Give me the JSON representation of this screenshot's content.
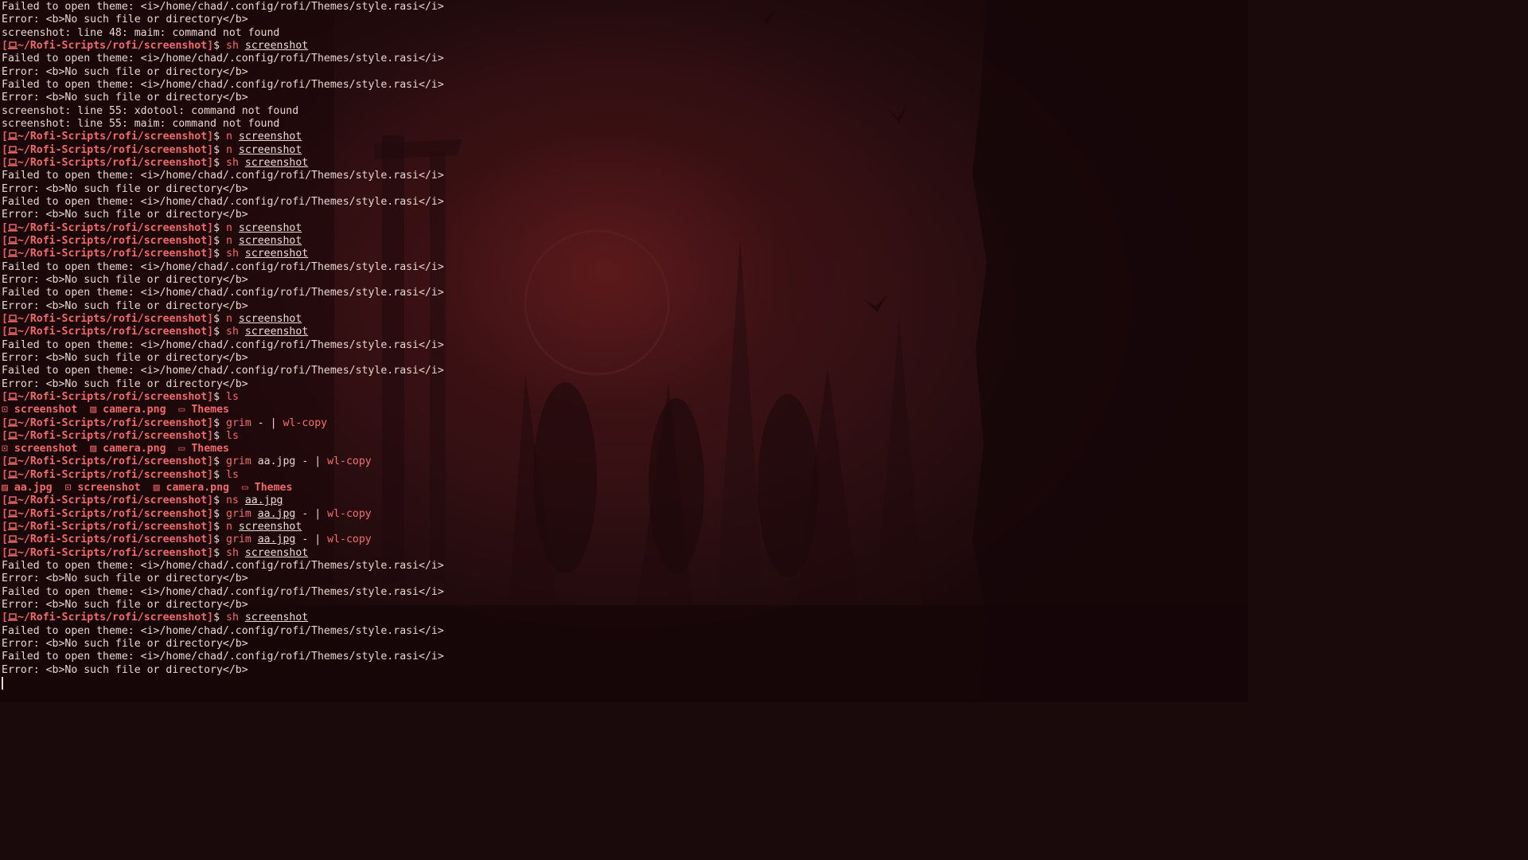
{
  "theme": {
    "prompt_color": "#f06a6c",
    "text_color": "#e8d6cf",
    "background": "#2a0d10"
  },
  "prompt": {
    "path": "~/Rofi-Scripts/rofi/screenshot",
    "open_bracket": "[",
    "close_bracket": "]",
    "dollar": "$",
    "icon": "laptop-icon"
  },
  "lines": [
    {
      "type": "out",
      "text": "Failed to open theme: <i>/home/chad/.config/rofi/Themes/style.rasi</i>"
    },
    {
      "type": "out",
      "text": "Error: <b>No such file or directory</b>"
    },
    {
      "type": "out",
      "text": "screenshot: line 48: maim: command not found"
    },
    {
      "type": "cmd",
      "cmd": "sh",
      "args": [
        {
          "t": "screenshot",
          "u": true
        }
      ]
    },
    {
      "type": "out",
      "text": "Failed to open theme: <i>/home/chad/.config/rofi/Themes/style.rasi</i>"
    },
    {
      "type": "out",
      "text": "Error: <b>No such file or directory</b>"
    },
    {
      "type": "out",
      "text": "Failed to open theme: <i>/home/chad/.config/rofi/Themes/style.rasi</i>"
    },
    {
      "type": "out",
      "text": "Error: <b>No such file or directory</b>"
    },
    {
      "type": "out",
      "text": "screenshot: line 55: xdotool: command not found"
    },
    {
      "type": "out",
      "text": "screenshot: line 55: maim: command not found"
    },
    {
      "type": "cmd",
      "cmd": "n",
      "args": [
        {
          "t": "screenshot",
          "u": true
        }
      ]
    },
    {
      "type": "cmd",
      "cmd": "n",
      "args": [
        {
          "t": "screenshot",
          "u": true
        }
      ]
    },
    {
      "type": "cmd",
      "cmd": "sh",
      "args": [
        {
          "t": "screenshot",
          "u": true
        }
      ]
    },
    {
      "type": "out",
      "text": "Failed to open theme: <i>/home/chad/.config/rofi/Themes/style.rasi</i>"
    },
    {
      "type": "out",
      "text": "Error: <b>No such file or directory</b>"
    },
    {
      "type": "out",
      "text": "Failed to open theme: <i>/home/chad/.config/rofi/Themes/style.rasi</i>"
    },
    {
      "type": "out",
      "text": "Error: <b>No such file or directory</b>"
    },
    {
      "type": "cmd",
      "cmd": "n",
      "args": [
        {
          "t": "screenshot",
          "u": true
        }
      ]
    },
    {
      "type": "cmd",
      "cmd": "n",
      "args": [
        {
          "t": "screenshot",
          "u": true
        }
      ]
    },
    {
      "type": "cmd",
      "cmd": "sh",
      "args": [
        {
          "t": "screenshot",
          "u": true
        }
      ]
    },
    {
      "type": "out",
      "text": "Failed to open theme: <i>/home/chad/.config/rofi/Themes/style.rasi</i>"
    },
    {
      "type": "out",
      "text": "Error: <b>No such file or directory</b>"
    },
    {
      "type": "out",
      "text": "Failed to open theme: <i>/home/chad/.config/rofi/Themes/style.rasi</i>"
    },
    {
      "type": "out",
      "text": "Error: <b>No such file or directory</b>"
    },
    {
      "type": "cmd",
      "cmd": "n",
      "args": [
        {
          "t": "screenshot",
          "u": true
        }
      ]
    },
    {
      "type": "cmd",
      "cmd": "sh",
      "args": [
        {
          "t": "screenshot",
          "u": true
        }
      ]
    },
    {
      "type": "out",
      "text": "Failed to open theme: <i>/home/chad/.config/rofi/Themes/style.rasi</i>"
    },
    {
      "type": "out",
      "text": "Error: <b>No such file or directory</b>"
    },
    {
      "type": "out",
      "text": "Failed to open theme: <i>/home/chad/.config/rofi/Themes/style.rasi</i>"
    },
    {
      "type": "out",
      "text": "Error: <b>No such file or directory</b>"
    },
    {
      "type": "cmd",
      "cmd": "ls",
      "args": []
    },
    {
      "type": "ls",
      "items": [
        {
          "icon": "terminal-file-icon",
          "glyph": "⊡",
          "name": "screenshot"
        },
        {
          "icon": "image-file-icon",
          "glyph": "▨",
          "name": "camera.png"
        },
        {
          "icon": "folder-icon",
          "glyph": "▭",
          "name": "Themes"
        }
      ]
    },
    {
      "type": "cmd",
      "cmd": "grim",
      "args": [
        {
          "t": "-",
          "u": false
        },
        {
          "t": "|",
          "u": false,
          "op": true
        },
        {
          "t": "wl-copy",
          "u": false,
          "pipe": true
        }
      ]
    },
    {
      "type": "cmd",
      "cmd": "ls",
      "args": []
    },
    {
      "type": "ls",
      "items": [
        {
          "icon": "terminal-file-icon",
          "glyph": "⊡",
          "name": "screenshot"
        },
        {
          "icon": "image-file-icon",
          "glyph": "▨",
          "name": "camera.png"
        },
        {
          "icon": "folder-icon",
          "glyph": "▭",
          "name": "Themes"
        }
      ]
    },
    {
      "type": "cmd",
      "cmd": "grim",
      "args": [
        {
          "t": "aa.jpg",
          "u": false
        },
        {
          "t": "-",
          "u": false
        },
        {
          "t": "|",
          "u": false,
          "op": true
        },
        {
          "t": "wl-copy",
          "u": false,
          "pipe": true
        }
      ]
    },
    {
      "type": "cmd",
      "cmd": "ls",
      "args": []
    },
    {
      "type": "ls",
      "items": [
        {
          "icon": "image-file-icon",
          "glyph": "▨",
          "name": "aa.jpg"
        },
        {
          "icon": "terminal-file-icon",
          "glyph": "⊡",
          "name": "screenshot"
        },
        {
          "icon": "image-file-icon",
          "glyph": "▨",
          "name": "camera.png"
        },
        {
          "icon": "folder-icon",
          "glyph": "▭",
          "name": "Themes"
        }
      ]
    },
    {
      "type": "cmd",
      "cmd": "ns",
      "args": [
        {
          "t": "aa.jpg",
          "u": true
        }
      ]
    },
    {
      "type": "cmd",
      "cmd": "grim",
      "args": [
        {
          "t": "aa.jpg",
          "u": true
        },
        {
          "t": "-",
          "u": false
        },
        {
          "t": "|",
          "u": false,
          "op": true
        },
        {
          "t": "wl-copy",
          "u": false,
          "pipe": true
        }
      ]
    },
    {
      "type": "cmd",
      "cmd": "n",
      "args": [
        {
          "t": "screenshot",
          "u": true
        }
      ]
    },
    {
      "type": "cmd",
      "cmd": "grim",
      "args": [
        {
          "t": "aa.jpg",
          "u": true
        },
        {
          "t": "-",
          "u": false
        },
        {
          "t": "|",
          "u": false,
          "op": true
        },
        {
          "t": "wl-copy",
          "u": false,
          "pipe": true
        }
      ]
    },
    {
      "type": "cmd",
      "cmd": "sh",
      "args": [
        {
          "t": "screenshot",
          "u": true
        }
      ]
    },
    {
      "type": "out",
      "text": "Failed to open theme: <i>/home/chad/.config/rofi/Themes/style.rasi</i>"
    },
    {
      "type": "out",
      "text": "Error: <b>No such file or directory</b>"
    },
    {
      "type": "out",
      "text": "Failed to open theme: <i>/home/chad/.config/rofi/Themes/style.rasi</i>"
    },
    {
      "type": "out",
      "text": "Error: <b>No such file or directory</b>"
    },
    {
      "type": "cmd",
      "cmd": "sh",
      "args": [
        {
          "t": "screenshot",
          "u": true
        }
      ]
    },
    {
      "type": "out",
      "text": "Failed to open theme: <i>/home/chad/.config/rofi/Themes/style.rasi</i>"
    },
    {
      "type": "out",
      "text": "Error: <b>No such file or directory</b>"
    },
    {
      "type": "out",
      "text": "Failed to open theme: <i>/home/chad/.config/rofi/Themes/style.rasi</i>"
    },
    {
      "type": "out",
      "text": "Error: <b>No such file or directory</b>"
    }
  ]
}
